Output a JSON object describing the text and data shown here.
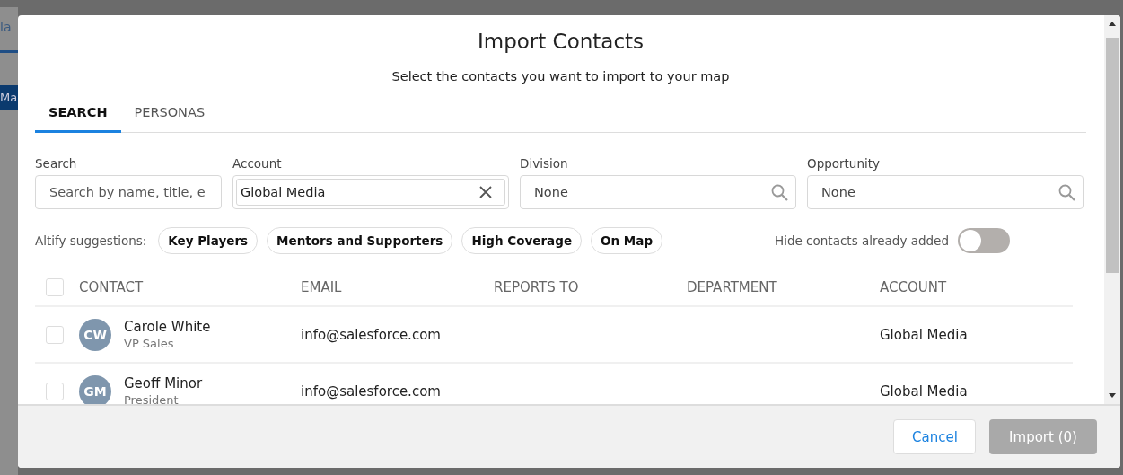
{
  "background": {
    "fragments": [
      "la",
      "Ma"
    ]
  },
  "dialog": {
    "title": "Import Contacts",
    "subtitle": "Select the contacts you want to import to your map"
  },
  "tabs": [
    {
      "label": "SEARCH",
      "selected": true
    },
    {
      "label": "PERSONAS",
      "selected": false
    }
  ],
  "filters": [
    {
      "label": "Search",
      "kind": "text",
      "placeholder": "Search by name, title, e"
    },
    {
      "label": "Account",
      "kind": "clearable",
      "value": "Global Media"
    },
    {
      "label": "Division",
      "kind": "lookup",
      "value": "None"
    },
    {
      "label": "Opportunity",
      "kind": "lookup",
      "value": "None"
    }
  ],
  "suggestions": {
    "label": "Altify suggestions:",
    "chips": [
      "Key Players",
      "Mentors and Supporters",
      "High Coverage",
      "On Map"
    ]
  },
  "hide_added": {
    "label": "Hide contacts already added",
    "on": false
  },
  "table": {
    "select_all": false,
    "columns": [
      "CONTACT",
      "EMAIL",
      "REPORTS TO",
      "DEPARTMENT",
      "ACCOUNT"
    ],
    "rows": [
      {
        "checked": false,
        "initials": "CW",
        "name": "Carole White",
        "title": "VP Sales",
        "email": "info@salesforce.com",
        "account": "Global Media"
      },
      {
        "checked": false,
        "initials": "GM",
        "name": "Geoff Minor",
        "title": "President",
        "email": "info@salesforce.com",
        "account": "Global Media"
      }
    ]
  },
  "footer": {
    "cancel": "Cancel",
    "import": {
      "label": "Import (0)",
      "disabled": true
    }
  }
}
